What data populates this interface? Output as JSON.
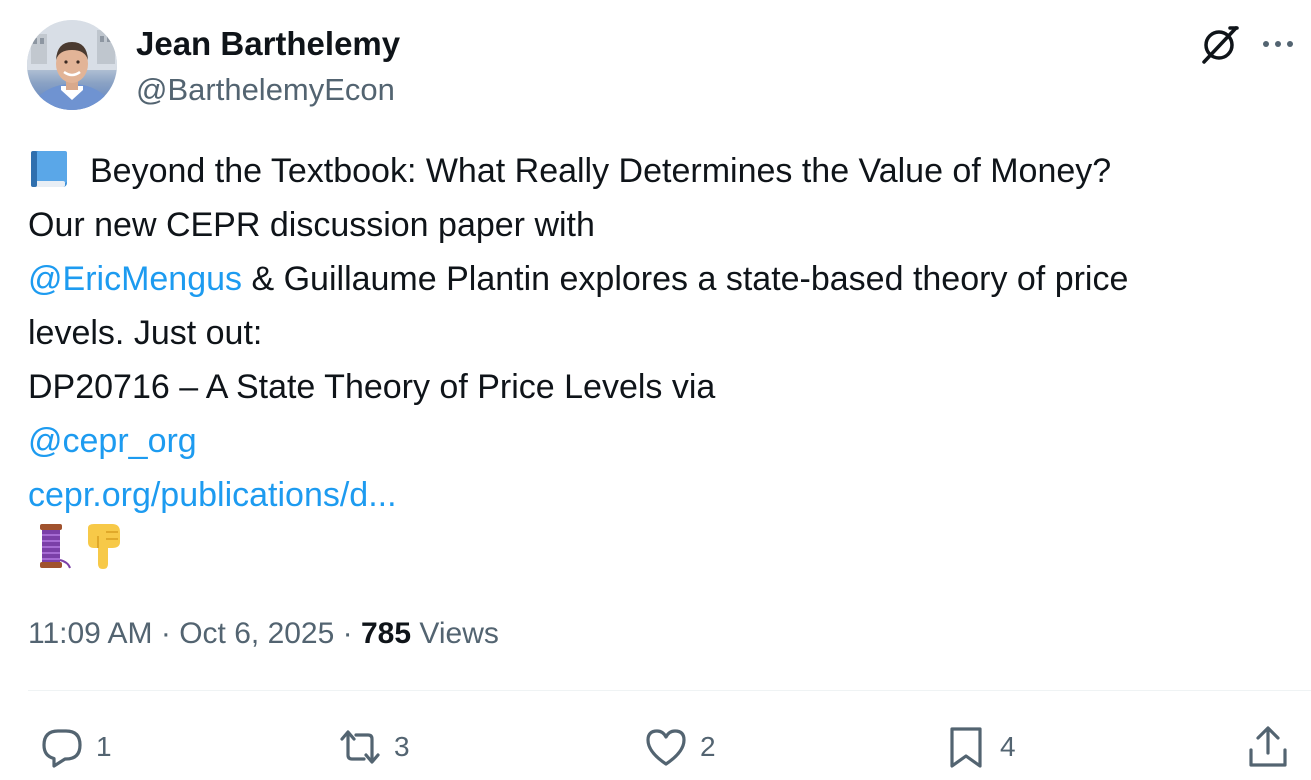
{
  "author": {
    "name": "Jean Barthelemy",
    "handle": "@BarthelemyEcon"
  },
  "icons": {
    "grok": "grok-icon",
    "more": "more-options-icon",
    "reply": "reply-icon",
    "retweet": "retweet-icon",
    "like": "heart-icon",
    "bookmark": "bookmark-icon",
    "share": "share-icon",
    "book_emoji": "blue-book-emoji",
    "thread_emoji": "thread-spool-emoji",
    "pointing_emoji": "backhand-index-pointing-down-emoji"
  },
  "tweet": {
    "line1": "Beyond the Textbook: What Really Determines the Value of Money?",
    "line2": "Our new CEPR discussion paper with",
    "mention1": "@EricMengus",
    "line3_rest": " & Guillaume Plantin explores a state-based theory of price",
    "line4": "levels. Just out:",
    "line5": "DP20716 – A State Theory of Price Levels via",
    "mention2": "@cepr_org",
    "link": "cepr.org/publications/d..."
  },
  "meta": {
    "time": "11:09 AM",
    "sep1": " · ",
    "date": "Oct 6, 2025",
    "sep2": " · ",
    "views_count": "785",
    "views_label": " Views"
  },
  "actions": {
    "replies": "1",
    "retweets": "3",
    "likes": "2",
    "bookmarks": "4"
  },
  "colors": {
    "link": "#1d9bf0",
    "secondary_text": "#536471",
    "primary_text": "#0f1419",
    "divider": "#eff3f4"
  }
}
